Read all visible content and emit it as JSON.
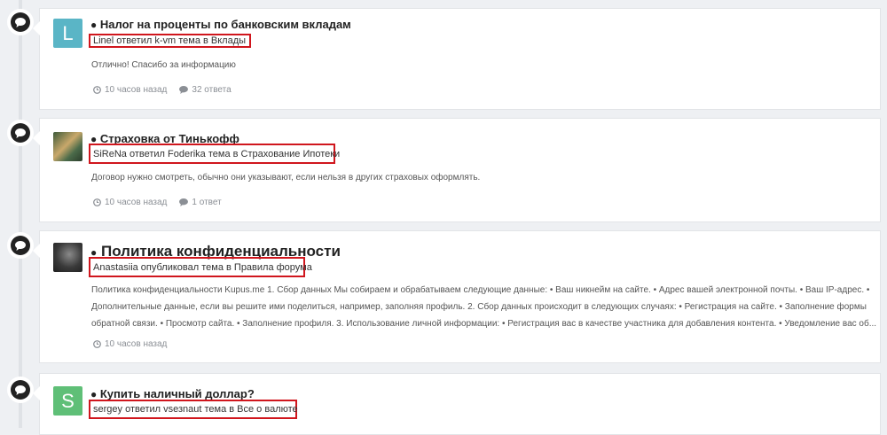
{
  "posts": [
    {
      "title": "Налог на проценты по банковским вкладам",
      "meta": "Linel ответил k-vm тема в Вклады",
      "avatar_letter": "L",
      "avatar_color": "#5ab5c6",
      "snippet": "Отлично! Спасибо за информацию",
      "time": "10 часов назад",
      "replies": "32 ответа"
    },
    {
      "title": "Страховка от Тинькофф",
      "meta": "SiReNa ответил Foderika тема в Страхование Ипотеки",
      "snippet": "Договор нужно смотреть, обычно они указывают, если нельзя в других страховых оформлять.",
      "time": "10 часов назад",
      "replies": "1 ответ"
    },
    {
      "title": "Политика конфиденциальности",
      "meta": "Anastasiia опубликовал тема в Правила форума",
      "snippet_lines": [
        "Политика конфиденциальности Kupus.me 1. Сбор данных Мы собираем и обрабатываем следующие данные: • Ваш никнейм на сайте. • Адрес вашей электронной почты. • Ваш IP-адрес. •",
        "Дополнительные данные, если вы решите ими поделиться, например, заполняя профиль. 2. Сбор данных происходит в следующих случаях: • Регистрация на сайте. • Заполнение формы",
        "обратной связи. • Просмотр сайта. • Заполнение профиля. 3. Использование личной информации: • Регистрация вас в качестве участника для добавления контента. • Уведомление вас об..."
      ],
      "time": "10 часов назад"
    },
    {
      "title": "Купить наличный доллар?",
      "meta": "sergey ответил vsезnaut тема в Все о валюте",
      "avatar_letter": "S",
      "avatar_color": "#5fbf77"
    }
  ],
  "bullet": "●",
  "icons": [
    "speech-bubble-icon",
    "clock-icon",
    "comment-icon"
  ]
}
